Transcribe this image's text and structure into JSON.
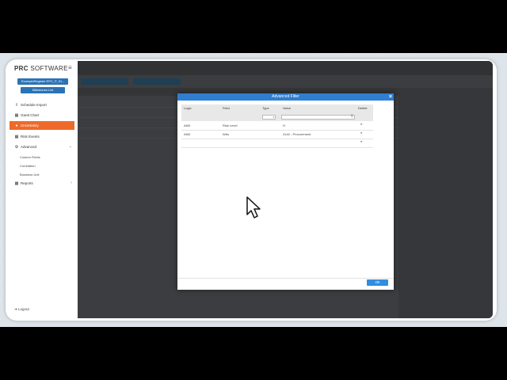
{
  "app": {
    "logo_mark": "PRC",
    "logo_text": "SOFTWARE"
  },
  "sidebar": {
    "project_button": "ExampleRegister EPC_P_St...",
    "milestones_button": "Milestones List",
    "items": [
      {
        "label": "Schedule Import",
        "icon": "upload-icon"
      },
      {
        "label": "Gantt Chart",
        "icon": "calendar-icon"
      },
      {
        "label": "Uncertainty",
        "icon": "uncertainty-icon",
        "active": true
      },
      {
        "label": "Risk Events",
        "icon": "risk-icon"
      },
      {
        "label": "Advanced",
        "icon": "gears-icon"
      },
      {
        "label": "Reports",
        "icon": "chart-icon"
      }
    ],
    "sub_items": [
      "Custom Fields",
      "Correlation",
      "Business Unit"
    ],
    "logout": "Logout"
  },
  "dialog": {
    "title": "Advanced Filter",
    "columns": {
      "logic": "Logic",
      "field": "Field",
      "type": "Type",
      "value": "Value",
      "delete": "Delete"
    },
    "rows": [
      {
        "logic": "AND",
        "field": "Risk Level",
        "value": "H"
      },
      {
        "logic": "AND",
        "field": "Wbs",
        "value": "4140 - Procurement"
      }
    ],
    "ok_label": "Ok"
  },
  "colors": {
    "accent": "#ee6a2b",
    "primary": "#2f7ecf",
    "button_blue": "#2a73b5"
  }
}
